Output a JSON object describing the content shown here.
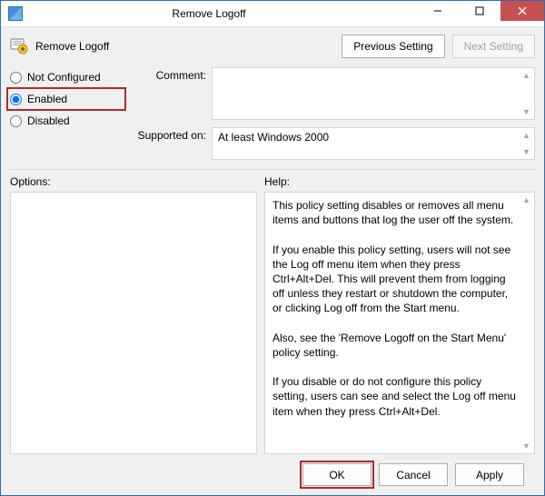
{
  "window": {
    "title": "Remove Logoff",
    "min_tip": "Minimize",
    "max_tip": "Maximize",
    "close_tip": "Close"
  },
  "header": {
    "policy_name": "Remove Logoff",
    "prev_btn": "Previous Setting",
    "next_btn": "Next Setting"
  },
  "state": {
    "not_configured": "Not Configured",
    "enabled": "Enabled",
    "disabled": "Disabled",
    "selected": "enabled"
  },
  "fields": {
    "comment_label": "Comment:",
    "comment_value": "",
    "supported_label": "Supported on:",
    "supported_value": "At least Windows 2000"
  },
  "lower": {
    "options_label": "Options:",
    "help_label": "Help:",
    "help_text": "This policy setting disables or removes all menu items and buttons that log the user off the system.\n\nIf you enable this policy setting, users will not see the Log off menu item when they press Ctrl+Alt+Del. This will prevent them from logging off unless they restart or shutdown the computer, or clicking Log off from the Start menu.\n\nAlso, see the 'Remove Logoff on the Start Menu' policy setting.\n\nIf you disable or do not configure this policy setting, users can see and select the Log off menu item when they press Ctrl+Alt+Del."
  },
  "buttons": {
    "ok": "OK",
    "cancel": "Cancel",
    "apply": "Apply"
  }
}
